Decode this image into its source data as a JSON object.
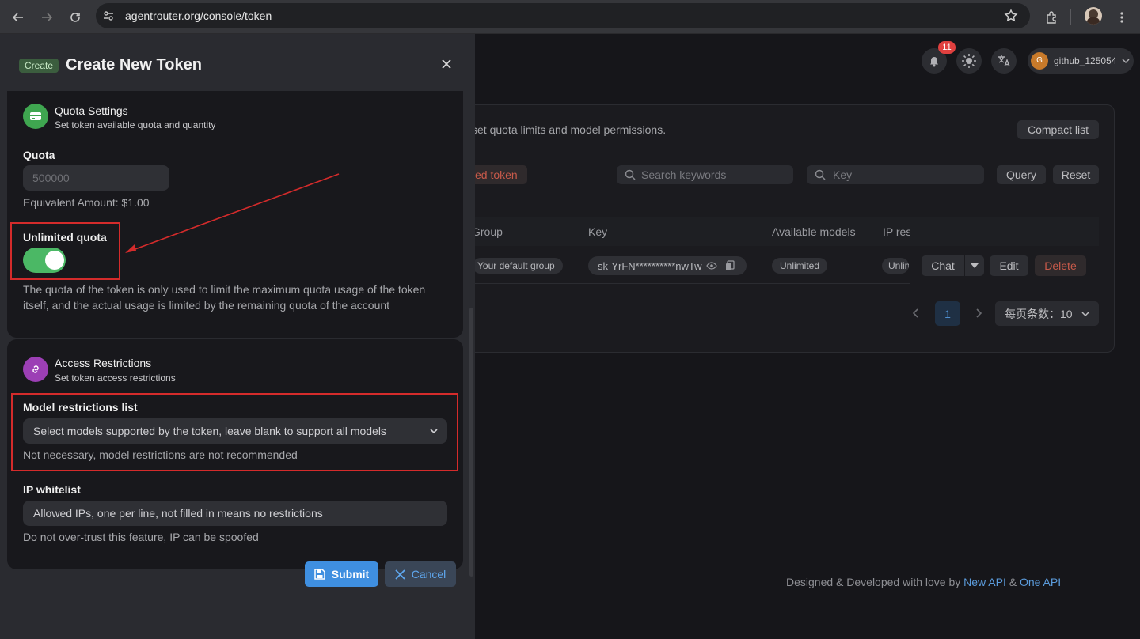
{
  "browser": {
    "url": "agentrouter.org/console/token"
  },
  "header": {
    "notification_count": "11",
    "username": "github_125054",
    "avatar_letter": "G"
  },
  "background": {
    "description_fragment": "set quota limits and model permissions.",
    "compact_list": "Compact list",
    "delete_token_fragment": "ed token",
    "search_placeholder": "Search keywords",
    "key_placeholder": "Key",
    "query": "Query",
    "reset": "Reset",
    "columns": [
      "Group",
      "Key",
      "Available models",
      "IP res"
    ],
    "row": {
      "group": "Your default group",
      "key": "sk-YrFN**********nwTw",
      "models": "Unlimited",
      "ip": "Unlin",
      "chat": "Chat",
      "edit": "Edit",
      "delete": "Delete"
    },
    "pagination": {
      "current_page": "1",
      "page_size": "每页条数：10"
    },
    "footer": {
      "prefix": "Designed & Developed with love by",
      "link1": "New API",
      "amp": "&",
      "link2": "One API"
    }
  },
  "modal": {
    "tag": "Create",
    "title": "Create New Token",
    "quota_section": {
      "title": "Quota Settings",
      "subtitle": "Set token available quota and quantity",
      "quota_label": "Quota",
      "quota_placeholder": "500000",
      "equivalent": "Equivalent Amount: $1.00",
      "unlimited_label": "Unlimited quota",
      "unlimited_enabled": true,
      "unlimited_help_line1": "The quota of the token is only used to limit the maximum quota usage of the token",
      "unlimited_help_line2": "itself, and the actual usage is limited by the remaining quota of the account"
    },
    "access_section": {
      "title": "Access Restrictions",
      "subtitle": "Set token access restrictions",
      "model_label": "Model restrictions list",
      "model_placeholder": "Select models supported by the token, leave blank to support all models",
      "model_help": "Not necessary, model restrictions are not recommended",
      "ip_label": "IP whitelist",
      "ip_placeholder": "Allowed IPs, one per line, not filled in means no restrictions",
      "ip_help": "Do not over-trust this feature, IP can be spoofed"
    },
    "submit": "Submit",
    "cancel": "Cancel"
  },
  "colors": {
    "toggle_on": "#4bb865",
    "primary": "#3f8fe0",
    "annotation_red": "#d42b2b",
    "delete_red": "#e0403f"
  }
}
